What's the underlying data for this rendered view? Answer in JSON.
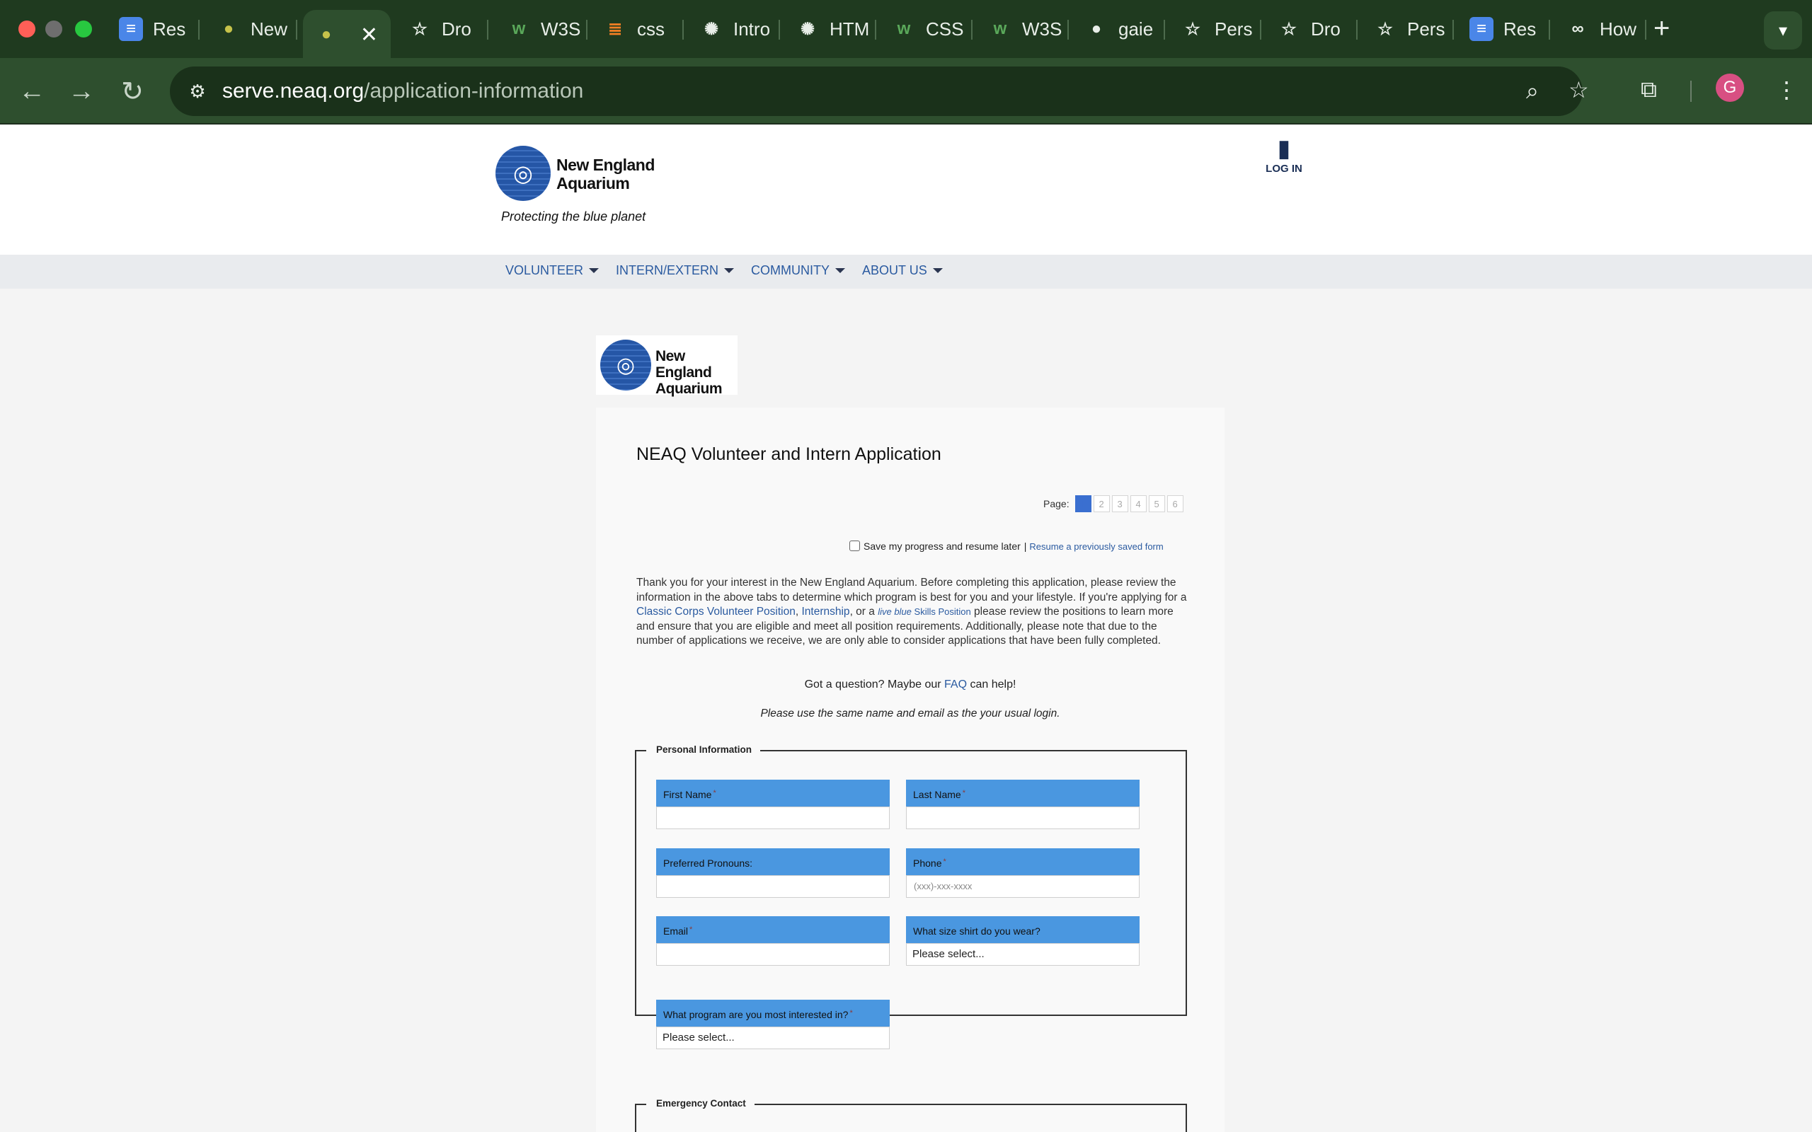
{
  "browser": {
    "tabs": [
      {
        "title": "Res",
        "icon": "docs-icon",
        "color": "#4a86e8"
      },
      {
        "title": "New",
        "icon": "colab-icon",
        "color": "#c6c24a"
      },
      {
        "title": "",
        "icon": "colab-icon",
        "color": "#c6c24a",
        "active": true
      },
      {
        "title": "Dro",
        "icon": "star-icon"
      },
      {
        "title": "W3S",
        "icon": "w3schools-icon",
        "color": "#5aa85a"
      },
      {
        "title": "css",
        "icon": "stackoverflow-icon",
        "color": "#f48024"
      },
      {
        "title": "Intro",
        "icon": "openai-icon"
      },
      {
        "title": "HTM",
        "icon": "openai-icon"
      },
      {
        "title": "CSS",
        "icon": "w3schools-icon",
        "color": "#5aa85a"
      },
      {
        "title": "W3S",
        "icon": "w3schools-icon",
        "color": "#5aa85a"
      },
      {
        "title": "gaie",
        "icon": "github-icon"
      },
      {
        "title": "Pers",
        "icon": "star-icon"
      },
      {
        "title": "Dro",
        "icon": "star-icon"
      },
      {
        "title": "Pers",
        "icon": "star-icon"
      },
      {
        "title": "Res",
        "icon": "docs-icon",
        "color": "#4a86e8"
      },
      {
        "title": "How",
        "icon": "infinity-icon"
      }
    ],
    "url_host": "serve.neaq.org",
    "url_path": "/application-information",
    "profile_initial": "G"
  },
  "site": {
    "logo_line1": "New England",
    "logo_line2": "Aquarium",
    "tagline": "Protecting the blue planet",
    "login_label": "LOG IN",
    "nav": [
      {
        "label": "VOLUNTEER"
      },
      {
        "label": "INTERN/EXTERN"
      },
      {
        "label": "COMMUNITY"
      },
      {
        "label": "ABOUT US"
      }
    ]
  },
  "form": {
    "title": "NEAQ Volunteer and Intern Application",
    "page_label": "Page:",
    "pages": [
      "1",
      "2",
      "3",
      "4",
      "5",
      "6"
    ],
    "current_page": 1,
    "save_progress_label": "Save my progress and resume later",
    "save_separator": "|",
    "resume_link": "Resume a previously saved form",
    "intro": {
      "p1": "Thank you for your interest in the New England Aquarium. Before completing this application, please review the information in the above tabs to determine which program is best for you and your lifestyle. If you're applying for a ",
      "link1": "Classic Corps Volunteer Position",
      "sep1": ", ",
      "link2": "Internship",
      "sep2": ", or a ",
      "link3a": "live blue",
      "link3b": " Skills Position",
      "p2": " please review the positions to learn more and ensure that you are eligible and meet all position requirements. Additionally, please note that due to the number of applications we receive, we are only able to consider applications that have been fully completed."
    },
    "question_pre": "Got a question? Maybe our ",
    "question_link": "FAQ",
    "question_post": " can help!",
    "login_note": "Please use the same name and email as the your usual login.",
    "sections": {
      "personal": "Personal Information",
      "emergency": "Emergency Contact"
    },
    "required_mark": "*",
    "fields": {
      "first_name": {
        "label": "First Name",
        "value": ""
      },
      "last_name": {
        "label": "Last Name",
        "value": ""
      },
      "pronouns": {
        "label": "Preferred Pronouns:",
        "value": ""
      },
      "phone": {
        "label": "Phone",
        "placeholder": "(xxx)-xxx-xxxx"
      },
      "email": {
        "label": "Email",
        "value": ""
      },
      "shirt_size": {
        "label": "What size shirt do you wear?",
        "selected": "Please select..."
      },
      "program": {
        "label": "What program are you most interested in?",
        "selected": "Please select..."
      }
    }
  }
}
